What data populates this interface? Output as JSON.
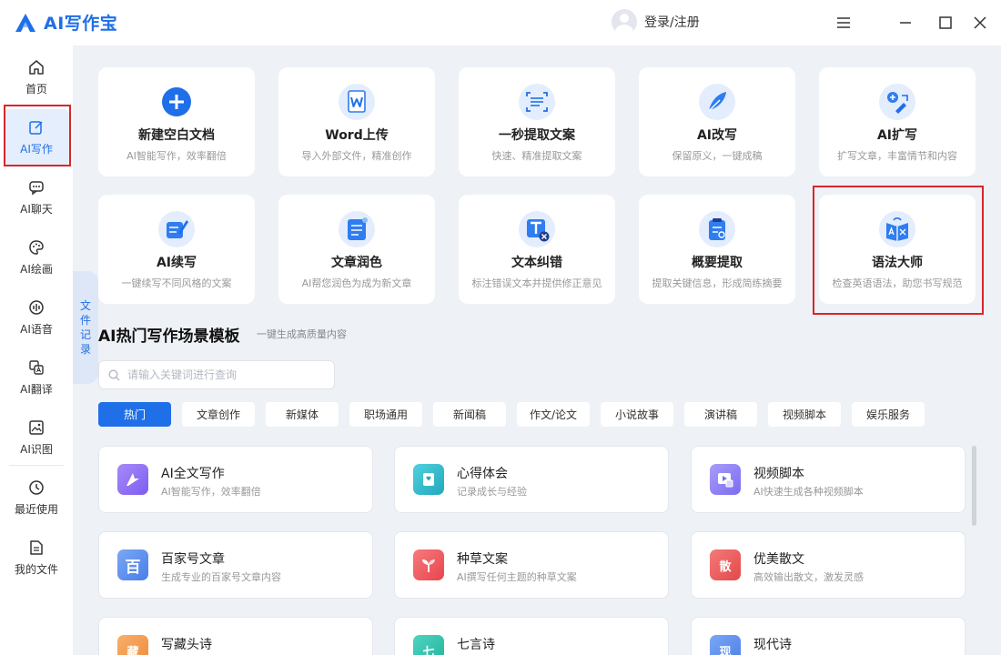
{
  "app": {
    "title": "AI写作宝",
    "login_label": "登录/注册"
  },
  "sidebar": {
    "items": [
      {
        "label": "首页",
        "icon": "home-icon"
      },
      {
        "label": "AI写作",
        "icon": "edit-icon",
        "active": true
      },
      {
        "label": "AI聊天",
        "icon": "chat-icon"
      },
      {
        "label": "AI绘画",
        "icon": "palette-icon"
      },
      {
        "label": "AI语音",
        "icon": "voice-icon"
      },
      {
        "label": "AI翻译",
        "icon": "translate-icon"
      },
      {
        "label": "AI识图",
        "icon": "image-recognize-icon"
      },
      {
        "label": "最近使用",
        "icon": "history-icon"
      },
      {
        "label": "我的文件",
        "icon": "file-icon"
      }
    ],
    "doc_record_tab": "文件记录"
  },
  "tools": [
    {
      "title": "新建空白文档",
      "desc": "AI智能写作，效率翻倍",
      "icon": "plus-circle-icon"
    },
    {
      "title": "Word上传",
      "desc": "导入外部文件，精准创作",
      "icon": "word-icon"
    },
    {
      "title": "一秒提取文案",
      "desc": "快速、精准提取文案",
      "icon": "scan-text-icon"
    },
    {
      "title": "AI改写",
      "desc": "保留原义，一键成稿",
      "icon": "feather-icon"
    },
    {
      "title": "AI扩写",
      "desc": "扩写文章，丰富情节和内容",
      "icon": "expand-write-icon"
    },
    {
      "title": "AI续写",
      "desc": "一键续写不同风格的文案",
      "icon": "continue-write-icon"
    },
    {
      "title": "文章润色",
      "desc": "AI帮您润色为成为新文章",
      "icon": "polish-doc-icon"
    },
    {
      "title": "文本纠错",
      "desc": "标注错误文本并提供修正意见",
      "icon": "text-correct-icon"
    },
    {
      "title": "概要提取",
      "desc": "提取关键信息，形成简练摘要",
      "icon": "summary-icon"
    },
    {
      "title": "语法大师",
      "desc": "检查英语语法，助您书写规范",
      "icon": "grammar-book-icon"
    }
  ],
  "templates_section": {
    "title": "AI热门写作场景模板",
    "subtitle": "一键生成高质量内容",
    "search_placeholder": "请输入关键词进行查询",
    "tabs": [
      "热门",
      "文章创作",
      "新媒体",
      "职场通用",
      "新闻稿",
      "作文/论文",
      "小说故事",
      "演讲稿",
      "视频脚本",
      "娱乐服务"
    ],
    "active_tab": "热门",
    "items": [
      {
        "title": "AI全文写作",
        "desc": "AI智能写作，效率翻倍",
        "icon": "ai-write-icon",
        "color": "#8b5cf6"
      },
      {
        "title": "心得体会",
        "desc": "记录成长与经验",
        "icon": "notebook-icon",
        "color": "#22b8c8"
      },
      {
        "title": "视频脚本",
        "desc": "AI快速生成各种视频脚本",
        "icon": "video-script-icon",
        "color": "#8b7cf6"
      },
      {
        "title": "百家号文章",
        "desc": "生成专业的百家号文章内容",
        "icon": "baijiahao-icon",
        "glyph": "百",
        "color": "#5b8def"
      },
      {
        "title": "种草文案",
        "desc": "AI撰写任何主题的种草文案",
        "icon": "sprout-icon",
        "color": "#f0555b"
      },
      {
        "title": "优美散文",
        "desc": "高效输出散文，激发灵感",
        "icon": "prose-icon",
        "glyph": "散",
        "color": "#ef5a5a"
      },
      {
        "title": "写藏头诗",
        "desc": "",
        "icon": "acrostic-poem-icon",
        "glyph": "藏",
        "color": "#f59a4a"
      },
      {
        "title": "七言诗",
        "desc": "",
        "icon": "seven-char-poem-icon",
        "glyph": "七",
        "color": "#2fbfaa"
      },
      {
        "title": "现代诗",
        "desc": "",
        "icon": "modern-poem-icon",
        "glyph": "现",
        "color": "#5b8def"
      }
    ]
  },
  "colors": {
    "accent": "#1f6fe8",
    "highlight": "#d9262b"
  }
}
